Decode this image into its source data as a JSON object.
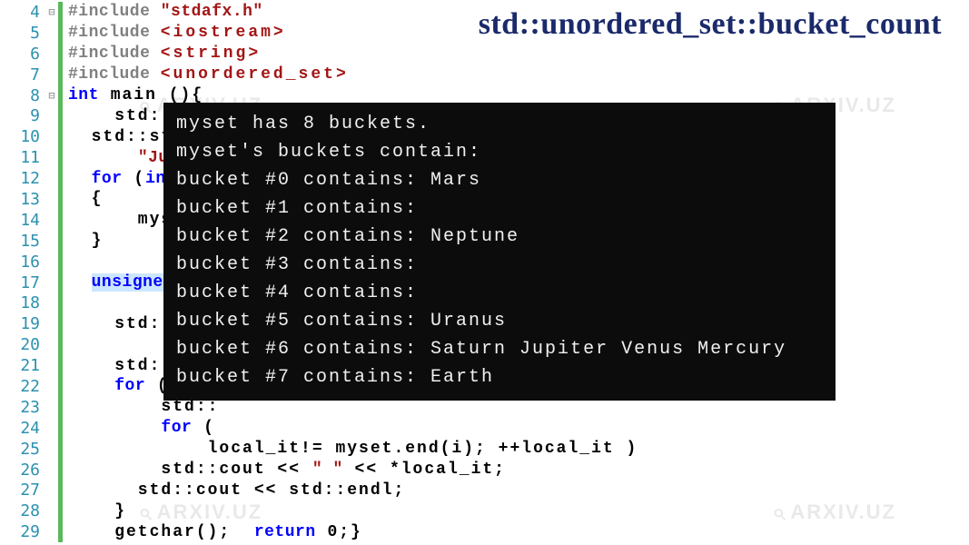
{
  "title": "std::unordered_set::bucket_count",
  "watermark_text": "ARXIV.UZ",
  "code_lines": [
    {
      "num": "4",
      "fold": "⊟",
      "tokens": [
        [
          "pp",
          "#include "
        ],
        [
          "str",
          "\"stdafx.h\""
        ]
      ]
    },
    {
      "num": "5",
      "fold": "",
      "tokens": [
        [
          "pp",
          "#include "
        ],
        [
          "inc",
          "<iostream>"
        ]
      ]
    },
    {
      "num": "6",
      "fold": "",
      "tokens": [
        [
          "pp",
          "#include "
        ],
        [
          "inc",
          "<string>"
        ]
      ]
    },
    {
      "num": "7",
      "fold": "",
      "tokens": [
        [
          "pp",
          "#include "
        ],
        [
          "inc",
          "<unordered_set>"
        ]
      ]
    },
    {
      "num": "8",
      "fold": "⊟",
      "tokens": [
        [
          "kw",
          "int"
        ],
        [
          "plain",
          " main (){"
        ]
      ]
    },
    {
      "num": "9",
      "fold": "",
      "tokens": [
        [
          "plain",
          "    std::unordered set<std::string> myset;"
        ]
      ]
    },
    {
      "num": "10",
      "fold": "",
      "tokens": [
        [
          "plain",
          "  std::str"
        ]
      ]
    },
    {
      "num": "11",
      "fold": "",
      "tokens": [
        [
          "plain",
          "      "
        ],
        [
          "str",
          "\"Jup"
        ]
      ]
    },
    {
      "num": "12",
      "fold": "",
      "tokens": [
        [
          "plain",
          "  "
        ],
        [
          "kw",
          "for"
        ],
        [
          "plain",
          " ("
        ],
        [
          "kw",
          "int"
        ]
      ]
    },
    {
      "num": "13",
      "fold": "",
      "tokens": [
        [
          "plain",
          "  {"
        ]
      ]
    },
    {
      "num": "14",
      "fold": "",
      "tokens": [
        [
          "plain",
          "      myse"
        ]
      ]
    },
    {
      "num": "15",
      "fold": "",
      "tokens": [
        [
          "plain",
          "  }"
        ]
      ]
    },
    {
      "num": "16",
      "fold": "",
      "tokens": []
    },
    {
      "num": "17",
      "fold": "",
      "tokens": [
        [
          "plain",
          "  "
        ],
        [
          "kw sel",
          "unsigned"
        ],
        [
          "plain",
          " "
        ]
      ]
    },
    {
      "num": "18",
      "fold": "",
      "tokens": []
    },
    {
      "num": "19",
      "fold": "",
      "tokens": [
        [
          "plain",
          "    std::co"
        ]
      ]
    },
    {
      "num": "20",
      "fold": "",
      "tokens": []
    },
    {
      "num": "21",
      "fold": "",
      "tokens": [
        [
          "plain",
          "    std::co"
        ]
      ]
    },
    {
      "num": "22",
      "fold": "",
      "tokens": [
        [
          "plain",
          "    "
        ],
        [
          "kw",
          "for"
        ],
        [
          "plain",
          " ( u"
        ]
      ]
    },
    {
      "num": "23",
      "fold": "",
      "tokens": [
        [
          "plain",
          "        std::"
        ]
      ]
    },
    {
      "num": "24",
      "fold": "",
      "tokens": [
        [
          "plain",
          "        "
        ],
        [
          "kw",
          "for"
        ],
        [
          "plain",
          " ("
        ]
      ]
    },
    {
      "num": "25",
      "fold": "",
      "tokens": [
        [
          "plain",
          "            local_it!= myset.end(i); ++local_it )"
        ]
      ]
    },
    {
      "num": "26",
      "fold": "",
      "tokens": [
        [
          "plain",
          "        std::cout << "
        ],
        [
          "str",
          "\" \""
        ],
        [
          "plain",
          " << *local_it;"
        ]
      ]
    },
    {
      "num": "27",
      "fold": "",
      "tokens": [
        [
          "plain",
          "      std::cout << std::endl;"
        ]
      ]
    },
    {
      "num": "28",
      "fold": "",
      "tokens": [
        [
          "plain",
          "    }"
        ]
      ]
    },
    {
      "num": "29",
      "fold": "",
      "tokens": [
        [
          "plain",
          "    getchar();  "
        ],
        [
          "kw",
          "return"
        ],
        [
          "plain",
          " 0;}"
        ]
      ]
    }
  ],
  "console_output": [
    "myset has 8 buckets.",
    "myset's buckets contain:",
    "bucket #0 contains: Mars",
    "bucket #1 contains:",
    "bucket #2 contains: Neptune",
    "bucket #3 contains:",
    "bucket #4 contains:",
    "bucket #5 contains: Uranus",
    "bucket #6 contains: Saturn Jupiter Venus Mercury",
    "bucket #7 contains: Earth"
  ]
}
